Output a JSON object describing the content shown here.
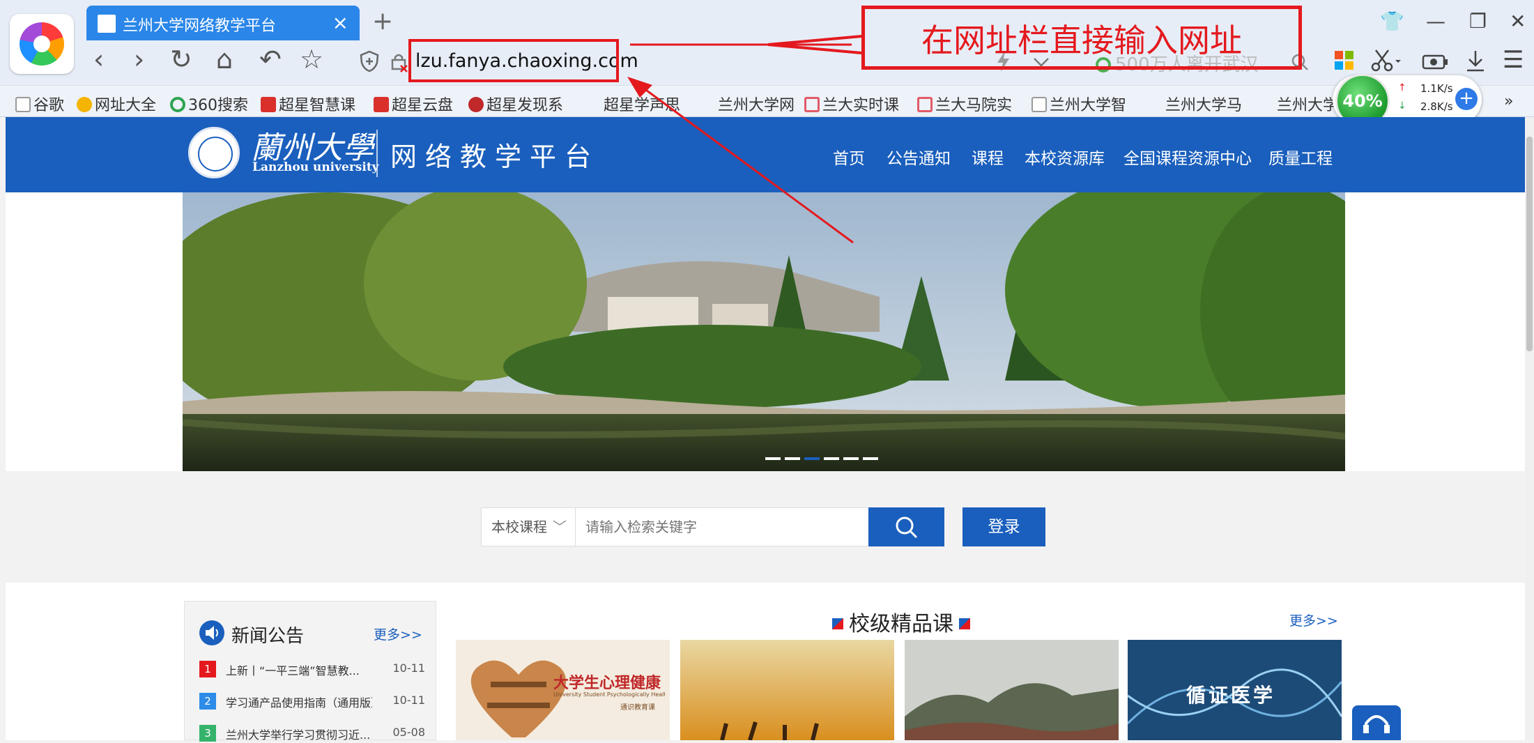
{
  "browser": {
    "tab_title": "兰州大学网络教学平台",
    "tab_close": "×",
    "new_tab": "+",
    "address": "lzu.fanya.chaoxing.com",
    "search_placeholder": "500万人离开武汉",
    "nav": {
      "back": "‹",
      "forward": "›",
      "reload": "↻",
      "home": "⌂",
      "undo": "↶",
      "star": "☆"
    },
    "window": {
      "shirt": "👕",
      "minimize": "—",
      "restore": "❐",
      "close": "✕"
    },
    "toolbar": {
      "menu": "☰",
      "more": "»"
    },
    "bookmarks": [
      {
        "label": "谷歌",
        "icon": "page-icon",
        "color": "#9aa"
      },
      {
        "label": "网址大全",
        "icon": "navigation-icon",
        "color": "#f5b400"
      },
      {
        "label": "360搜索",
        "icon": "search360-icon",
        "color": "#2ea44f"
      },
      {
        "label": "超星智慧课",
        "icon": "chaoxing-icon",
        "color": "#d9302c"
      },
      {
        "label": "超星云盘",
        "icon": "chaoxing-icon",
        "color": "#d9302c"
      },
      {
        "label": "超星发现系",
        "icon": "chaoxing-icon",
        "color": "#c0282a"
      },
      {
        "label": "超星学声思",
        "icon": "none",
        "color": ""
      },
      {
        "label": "兰州大学网",
        "icon": "none",
        "color": ""
      },
      {
        "label": "兰大实时课",
        "icon": "book-icon",
        "color": "#e25b68"
      },
      {
        "label": "兰大马院实",
        "icon": "book-icon",
        "color": "#e25b68"
      },
      {
        "label": "兰州大学智",
        "icon": "page-icon",
        "color": "#9aa"
      },
      {
        "label": "兰州大学马",
        "icon": "none",
        "color": ""
      },
      {
        "label": "兰州大学",
        "icon": "none",
        "color": ""
      }
    ],
    "speed": {
      "percent": "40%",
      "up": "1.1K/s",
      "down": "2.8K/s"
    }
  },
  "annotation": {
    "text": "在网址栏直接输入网址",
    "color": "#e4191e"
  },
  "site": {
    "logo_cn": "蘭州大學",
    "logo_en": "Lanzhou university",
    "platform_name": "网络教学平台",
    "nav": [
      "首页",
      "公告通知",
      "课程",
      "本校资源库",
      "全国课程资源中心",
      "质量工程"
    ],
    "search": {
      "category": "本校课程",
      "placeholder": "请输入检索关键字",
      "login": "登录"
    },
    "news": {
      "title": "新闻公告",
      "more": "更多>>",
      "items": [
        {
          "num": "1",
          "text": "上新丨“一平三端”智慧教...",
          "date": "10-11",
          "color": "#e4191e"
        },
        {
          "num": "2",
          "text": "学习通产品使用指南（通用版）",
          "date": "10-11",
          "color": "#2d8ce8"
        },
        {
          "num": "3",
          "text": "兰州大学举行学习贯彻习近...",
          "date": "05-08",
          "color": "#35b36b"
        }
      ]
    },
    "courses": {
      "title": "校级精品课",
      "more": "更多>>",
      "card1_title": "大学生心理健康",
      "card1_en": "University Student Psychologically Healthy",
      "card1_sub": "通识教育课",
      "card4_title": "循证医学"
    }
  },
  "theme": {
    "brand_blue": "#1a5fbd",
    "tab_blue": "#2a86e8",
    "accent_red": "#e4191e"
  }
}
